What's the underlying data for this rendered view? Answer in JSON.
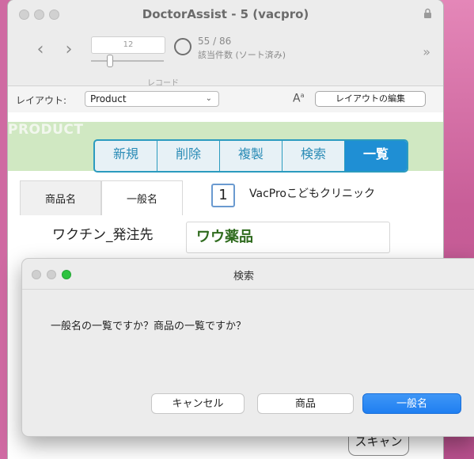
{
  "window": {
    "title": "DoctorAssist - 5 (vacpro)"
  },
  "toolbar": {
    "record_value": "12",
    "record_caption": "レコード",
    "found_count": "55 / 86",
    "found_caption": "該当件数 (ソート済み)"
  },
  "layout_bar": {
    "label": "レイアウト:",
    "selected_layout": "Product",
    "edit_button": "レイアウトの編集"
  },
  "header": {
    "watermark": "PRODUCT",
    "tabs": [
      {
        "label": "新規",
        "active": false
      },
      {
        "label": "削除",
        "active": false
      },
      {
        "label": "複製",
        "active": false
      },
      {
        "label": "検索",
        "active": false
      },
      {
        "label": "一覧",
        "active": true
      }
    ]
  },
  "form": {
    "field_tabs": [
      "商品名",
      "一般名"
    ],
    "page_number": "1",
    "clinic_name": "VacProこどもクリニック",
    "vendor_label": "ワクチン_発注先",
    "vendor_value": "ワウ薬品",
    "scan_button": "スキャン"
  },
  "dialog": {
    "title": "検索",
    "message": "一般名の一覧ですか？商品の一覧ですか？",
    "buttons": {
      "cancel": "キャンセル",
      "product": "商品",
      "generic": "一般名"
    }
  },
  "colors": {
    "header_band": "#d0e8c2",
    "tab_accent": "#2b9bbf",
    "active_tab": "#1f8fd4",
    "default_button": "#1f7ff1",
    "desktop": "#cf6aa2"
  }
}
